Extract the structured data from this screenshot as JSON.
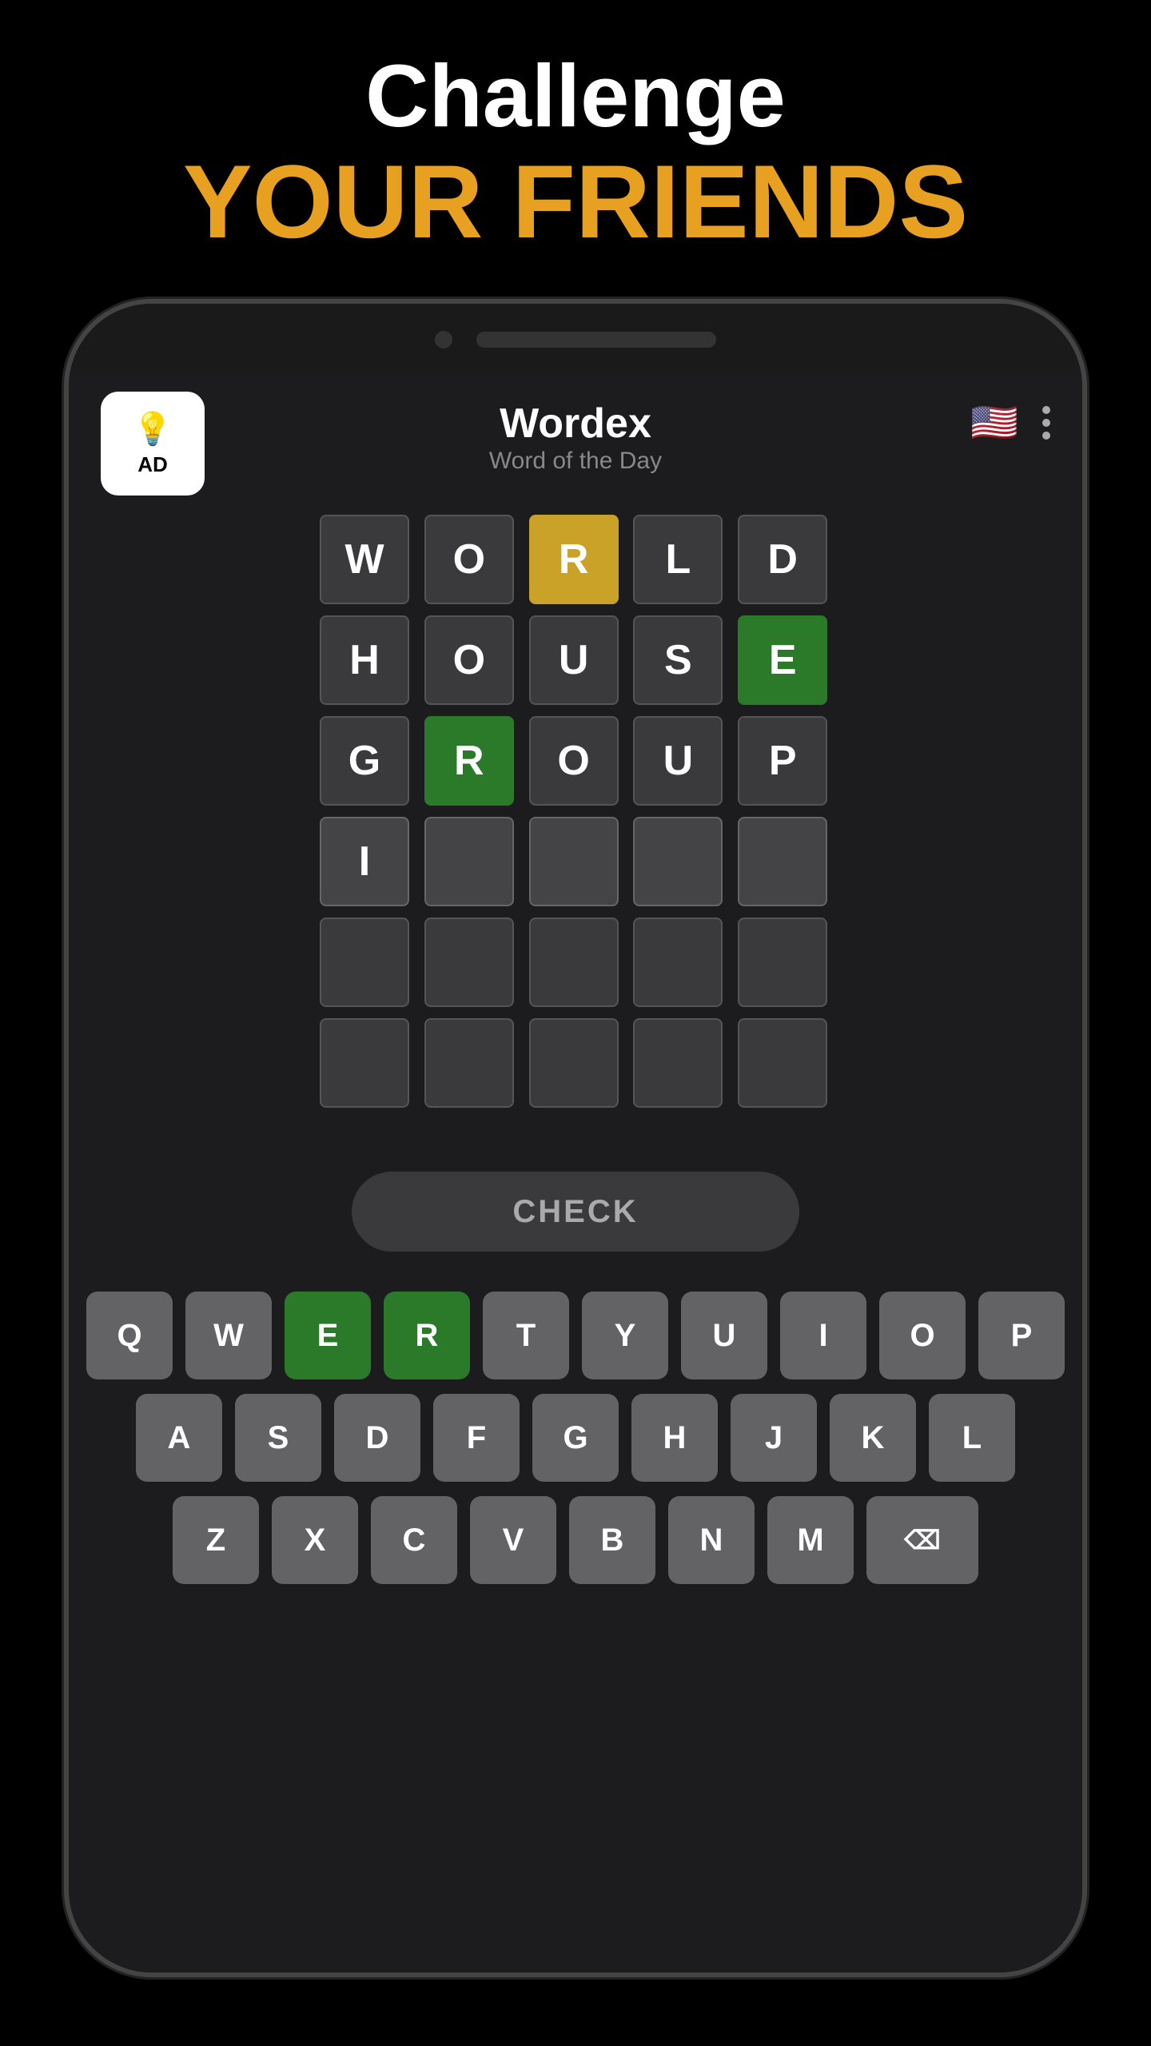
{
  "header": {
    "challenge": "Challenge",
    "friends": "YOUR FRIENDS"
  },
  "app": {
    "title": "Wordex",
    "subtitle": "Word of the Day",
    "ad_label": "AD"
  },
  "grid": {
    "rows": [
      [
        {
          "letter": "W",
          "state": "empty"
        },
        {
          "letter": "O",
          "state": "empty"
        },
        {
          "letter": "R",
          "state": "yellow"
        },
        {
          "letter": "L",
          "state": "empty"
        },
        {
          "letter": "D",
          "state": "empty"
        }
      ],
      [
        {
          "letter": "H",
          "state": "empty"
        },
        {
          "letter": "O",
          "state": "empty"
        },
        {
          "letter": "U",
          "state": "empty"
        },
        {
          "letter": "S",
          "state": "empty"
        },
        {
          "letter": "E",
          "state": "green"
        }
      ],
      [
        {
          "letter": "G",
          "state": "empty"
        },
        {
          "letter": "R",
          "state": "green"
        },
        {
          "letter": "O",
          "state": "empty"
        },
        {
          "letter": "U",
          "state": "empty"
        },
        {
          "letter": "P",
          "state": "empty"
        }
      ],
      [
        {
          "letter": "I",
          "state": "active"
        },
        {
          "letter": "",
          "state": "active-empty"
        },
        {
          "letter": "",
          "state": "active-empty"
        },
        {
          "letter": "",
          "state": "active-empty"
        },
        {
          "letter": "",
          "state": "active-empty"
        }
      ],
      [
        {
          "letter": "",
          "state": "empty"
        },
        {
          "letter": "",
          "state": "empty"
        },
        {
          "letter": "",
          "state": "empty"
        },
        {
          "letter": "",
          "state": "empty"
        },
        {
          "letter": "",
          "state": "empty"
        }
      ],
      [
        {
          "letter": "",
          "state": "empty"
        },
        {
          "letter": "",
          "state": "empty"
        },
        {
          "letter": "",
          "state": "empty"
        },
        {
          "letter": "",
          "state": "empty"
        },
        {
          "letter": "",
          "state": "empty"
        }
      ]
    ]
  },
  "check_button": "CHECK",
  "keyboard": {
    "row1": [
      "Q",
      "W",
      "E",
      "R",
      "T",
      "Y",
      "U",
      "I",
      "O",
      "P"
    ],
    "row2": [
      "A",
      "S",
      "D",
      "F",
      "G",
      "H",
      "J",
      "K",
      "L"
    ],
    "row3": [
      "Z",
      "X",
      "C",
      "V",
      "B",
      "N",
      "M",
      "⌫"
    ],
    "green_keys": [
      "E",
      "R"
    ]
  }
}
